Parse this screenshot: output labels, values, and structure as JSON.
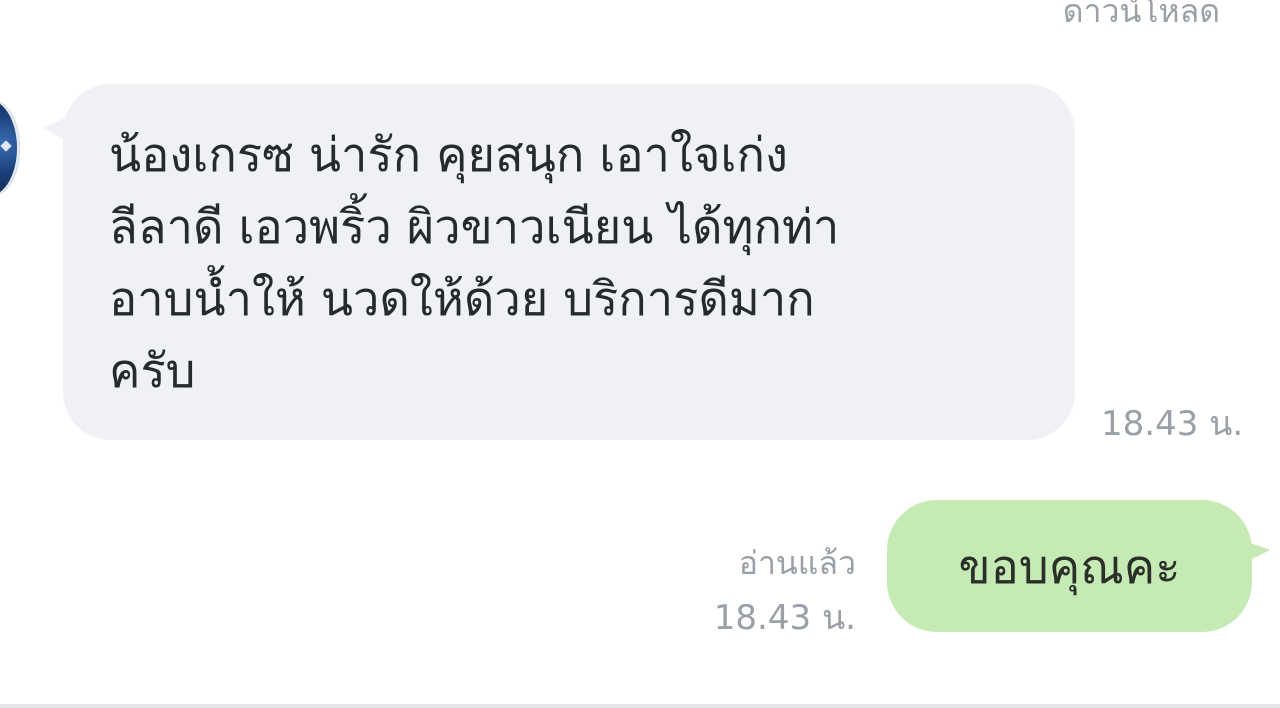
{
  "header": {
    "partial_label": "ดาวน์โหลด"
  },
  "incoming_message": {
    "lines": [
      "น้องเกรซ น่ารัก คุยสนุก เอาใจเก่ง",
      "ลีลาดี เอวพริ้ว ผิวขาวเนียน ได้ทุกท่า",
      "อาบน้ำให้ นวดให้ด้วย บริการดีมาก",
      "ครับ"
    ],
    "time": "18.43 น."
  },
  "outgoing_message": {
    "text": "ขอบคุณคะ",
    "read_status": "อ่านแล้ว",
    "time": "18.43 น."
  },
  "colors": {
    "incoming_bubble": "#eff1f4",
    "outgoing_bubble": "#c6eab3",
    "meta_text": "#9aa0a6",
    "body_text": "#262a2e"
  },
  "icons": {
    "avatar": "user-avatar"
  }
}
